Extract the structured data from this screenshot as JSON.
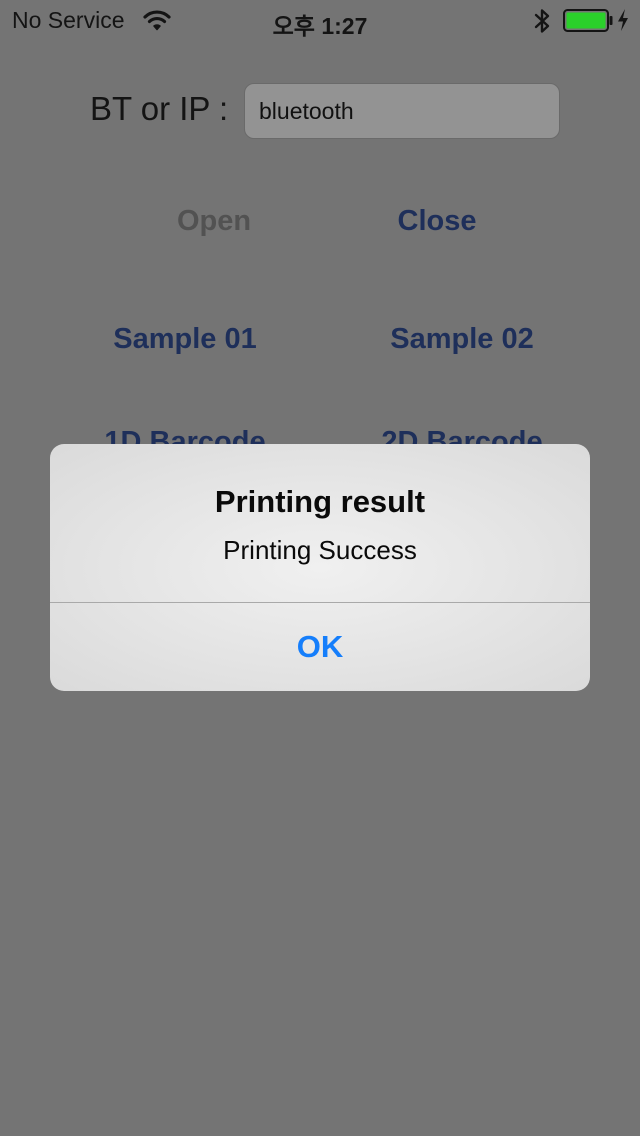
{
  "status_bar": {
    "carrier": "No Service",
    "time": "오후 1:27",
    "battery_color": "#2bd02b",
    "icons": [
      "wifi-icon",
      "bluetooth-icon",
      "battery-icon",
      "charging-icon"
    ]
  },
  "form": {
    "address_label": "BT or IP :",
    "address_value": "bluetooth"
  },
  "buttons": {
    "open": "Open",
    "close": "Close",
    "sample_01": "Sample 01",
    "sample_02": "Sample 02",
    "barcode_1d": "1D Barcode",
    "barcode_2d": "2D Barcode"
  },
  "alert": {
    "title": "Printing result",
    "message": "Printing Success",
    "ok_label": "OK",
    "ok_color": "#157efb"
  }
}
